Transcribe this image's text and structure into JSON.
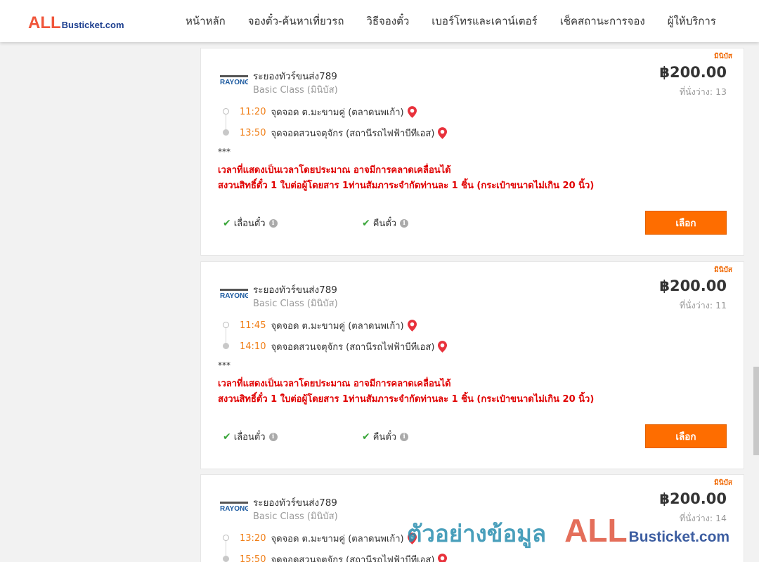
{
  "header": {
    "logo_all": "ALL",
    "logo_rest": "Busticket.com",
    "nav": [
      "หน้าหลัก",
      "จองตั๋ว-ค้นหาเที่ยวรถ",
      "วิธีจองตั๋ว",
      "เบอร์โทรและเคาน์เตอร์",
      "เช็คสถานะการจอง",
      "ผู้ให้บริการ"
    ]
  },
  "results": [
    {
      "tag": "มินิบัส",
      "operator": "ระยองทัวร์ขนส่ง789",
      "class": "Basic Class (มินิบัส)",
      "price": "฿200.00",
      "seats": "ที่นั่งว่าง: 13",
      "depart_time": "11:20",
      "depart_stop": "จุดจอด ต.มะขามคู่ (ตลาดนพเก้า)",
      "arrive_time": "13:50",
      "arrive_stop": "จุดจอดสวนจตุจักร (สถานีรถไฟฟ้าบีทีเอส)",
      "stars": "***",
      "notice1": "เวลาที่แสดงเป็นเวลาโดยประมาณ อาจมีการคลาดเคลื่อนได้",
      "notice2": "สงวนสิทธิ์ตั๋ว 1 ใบต่อผู้โดยสาร 1ท่านสัมภาระจำกัดท่านละ 1 ชิ้น (กระเป๋าขนาดไม่เกิน 20 นิ้ว)",
      "policy1": "เลื่อนตั๋ว",
      "policy2": "คืนตั๋ว",
      "button": "เลือก"
    },
    {
      "tag": "มินิบัส",
      "operator": "ระยองทัวร์ขนส่ง789",
      "class": "Basic Class (มินิบัส)",
      "price": "฿200.00",
      "seats": "ที่นั่งว่าง: 11",
      "depart_time": "11:45",
      "depart_stop": "จุดจอด ต.มะขามคู่ (ตลาดนพเก้า)",
      "arrive_time": "14:10",
      "arrive_stop": "จุดจอดสวนจตุจักร (สถานีรถไฟฟ้าบีทีเอส)",
      "stars": "***",
      "notice1": "เวลาที่แสดงเป็นเวลาโดยประมาณ อาจมีการคลาดเคลื่อนได้",
      "notice2": "สงวนสิทธิ์ตั๋ว 1 ใบต่อผู้โดยสาร 1ท่านสัมภาระจำกัดท่านละ 1 ชิ้น (กระเป๋าขนาดไม่เกิน 20 นิ้ว)",
      "policy1": "เลื่อนตั๋ว",
      "policy2": "คืนตั๋ว",
      "button": "เลือก"
    },
    {
      "tag": "มินิบัส",
      "operator": "ระยองทัวร์ขนส่ง789",
      "class": "Basic Class (มินิบัส)",
      "price": "฿200.00",
      "seats": "ที่นั่งว่าง: 14",
      "depart_time": "13:20",
      "depart_stop": "จุดจอด ต.มะขามคู่ (ตลาดนพเก้า)",
      "arrive_time": "15:50",
      "arrive_stop": "จุดจอดสวนจตุจักร (สถานีรถไฟฟ้าบีทีเอส)"
    }
  ],
  "operator_logo_text": "RAYONG",
  "watermark": {
    "text": "ตัวอย่างข้อมูล",
    "all": "ALL",
    "rest": "Busticket.com"
  },
  "colors": {
    "accent_orange": "#fe6d00",
    "time_orange": "#f07e16",
    "notice_red": "#e00000",
    "check_green": "#3aa63a",
    "brand_red": "#f0553a",
    "brand_blue": "#1d3f8f"
  }
}
